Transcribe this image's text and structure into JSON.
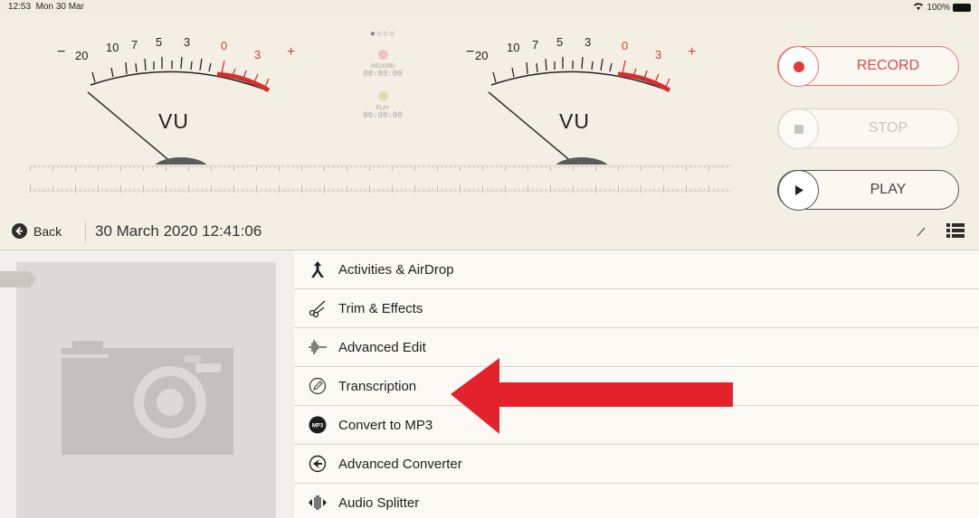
{
  "status": {
    "time": "12:53",
    "date": "Mon 30 Mar",
    "battery": "100%"
  },
  "meters": [
    {
      "label": "VU",
      "scale": [
        "20",
        "10",
        "7",
        "5",
        "3",
        "0",
        "3"
      ],
      "minus": "−",
      "plus": "+"
    },
    {
      "label": "VU",
      "scale": [
        "20",
        "10",
        "7",
        "5",
        "3",
        "0",
        "3"
      ],
      "minus": "−",
      "plus": "+"
    }
  ],
  "center": {
    "dots": "●○○○",
    "record_label": "RECORD",
    "record_time": "00:00:00",
    "play_label": "PLAY",
    "play_time": "00:00:00"
  },
  "buttons": {
    "record": "RECORD",
    "stop": "STOP",
    "play": "PLAY"
  },
  "nav": {
    "back": "Back",
    "title": "30 March 2020 12:41:06"
  },
  "menu": [
    {
      "label": "Activities & AirDrop",
      "icon": "airdrop-icon"
    },
    {
      "label": "Trim & Effects",
      "icon": "scissors-icon"
    },
    {
      "label": "Advanced Edit",
      "icon": "waveform-icon"
    },
    {
      "label": "Transcription",
      "icon": "pencil-circle-icon"
    },
    {
      "label": "Convert to MP3",
      "icon": "mp3-icon"
    },
    {
      "label": "Advanced Converter",
      "icon": "converter-icon"
    },
    {
      "label": "Audio Splitter",
      "icon": "splitter-icon"
    }
  ],
  "colors": {
    "accent": "#e53935",
    "record_red": "#d74a4a",
    "arrow": "#e3222b"
  }
}
